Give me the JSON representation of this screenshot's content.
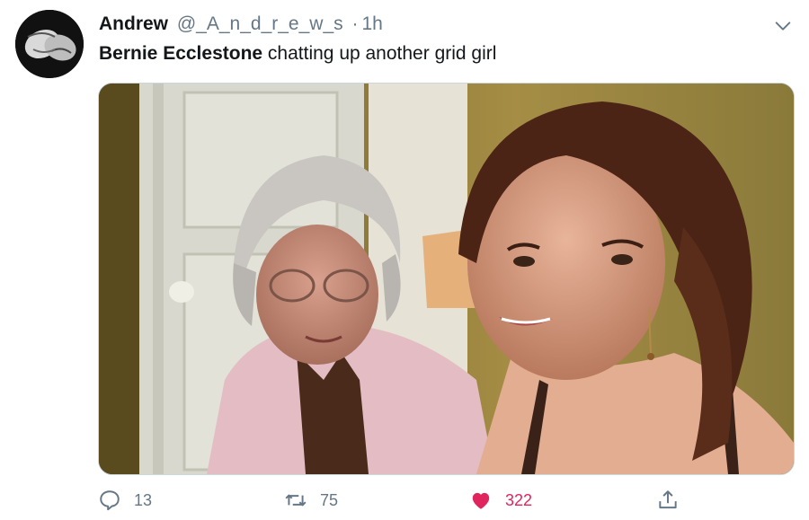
{
  "tweet": {
    "display_name": "Andrew",
    "handle": "@_A_n_d_r_e_w_s",
    "separator": "·",
    "time": "1h",
    "text_bold": "Bernie Ecclestone",
    "text_rest": " chatting up another grid girl"
  },
  "actions": {
    "reply_count": "13",
    "retweet_count": "75",
    "like_count": "322"
  },
  "icons": {
    "reply": "reply-icon",
    "retweet": "retweet-icon",
    "like": "heart-icon",
    "share": "share-icon",
    "menu": "chevron-down-icon"
  },
  "colors": {
    "like": "#e0245e",
    "muted": "#657786",
    "text": "#14171a"
  }
}
